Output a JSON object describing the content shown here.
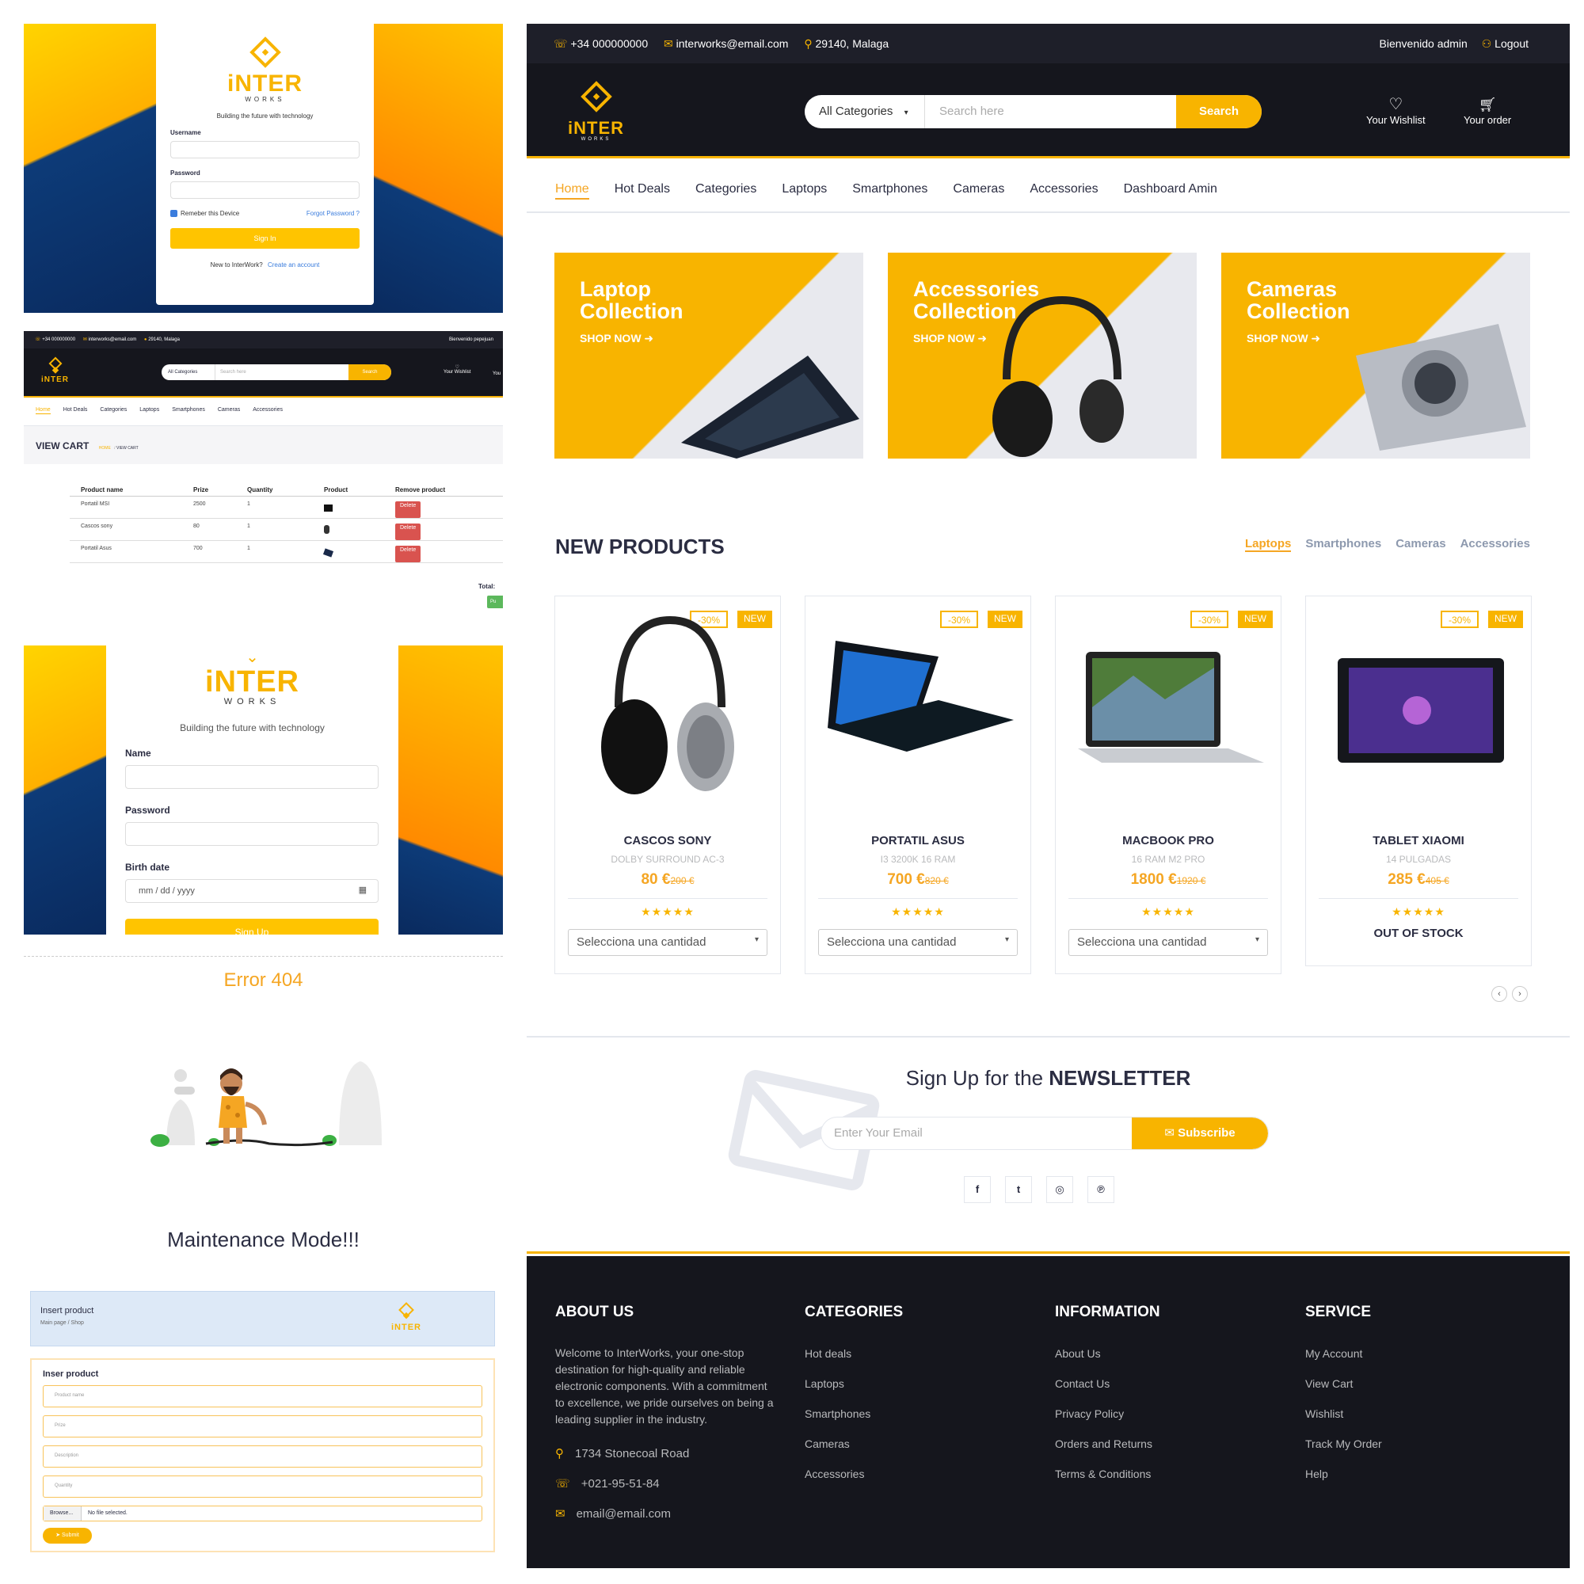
{
  "brand": {
    "name": "iNTER",
    "sub": "WORKS",
    "tagline": "Building the future with technology"
  },
  "login": {
    "username_label": "Username",
    "password_label": "Password",
    "remember_label": "Remeber this Device",
    "forgot_link": "Forgot Password ?",
    "signin_button": "Sign In",
    "new_text": "New to InterWork?",
    "create_link": "Create an account"
  },
  "cart_page": {
    "topbar": {
      "phone": "+34 000000000",
      "email": "interworks@email.com",
      "location": "29140, Malaga",
      "welcome": "Bienvenido pepejuan"
    },
    "search": {
      "category": "All Categories",
      "placeholder": "Search here",
      "button": "Search"
    },
    "wishlist": "Your Wishlist",
    "your_cut": "You",
    "nav": [
      "Home",
      "Hot Deals",
      "Categories",
      "Laptops",
      "Smartphones",
      "Cameras",
      "Accessories"
    ],
    "title": "VIEW CART",
    "breadcrumb": [
      "HOME",
      "VIEW CART"
    ],
    "columns": [
      "Product name",
      "Prize",
      "Quantity",
      "Product",
      "Remove product"
    ],
    "rows": [
      {
        "name": "Portatil MSI",
        "price": "2500",
        "qty": "1",
        "action": "Delete"
      },
      {
        "name": "Cascos sony",
        "price": "80",
        "qty": "1",
        "action": "Delete"
      },
      {
        "name": "Portatil Asus",
        "price": "700",
        "qty": "1",
        "action": "Delete"
      }
    ],
    "total": "Total: ",
    "buy_cut": "Pu"
  },
  "signup": {
    "name_label": "Name",
    "password_label": "Password",
    "birth_label": "Birth date",
    "birth_placeholder": "mm / dd / yyyy",
    "signup_button": "Sign Up"
  },
  "error_page": {
    "title": "Error 404",
    "message": "Maintenance Mode!!!"
  },
  "insert_page": {
    "header_title": "Insert product",
    "breadcrumb": [
      "Main page",
      "Shop"
    ],
    "form_title": "Inser product",
    "placeholders": [
      "Product name",
      "Prize",
      "Description",
      "Quantity"
    ],
    "browse": "Browse...",
    "no_file": "No file selected.",
    "submit": "Submit"
  },
  "home": {
    "topbar": {
      "phone": "+34 000000000",
      "email": "interworks@email.com",
      "location": "29140, Malaga",
      "welcome": "Bienvenido admin",
      "logout": "Logout"
    },
    "search": {
      "category": "All Categories",
      "placeholder": "Search here",
      "button": "Search"
    },
    "wishlist": "Your Wishlist",
    "order": "Your order",
    "nav": [
      "Home",
      "Hot Deals",
      "Categories",
      "Laptops",
      "Smartphones",
      "Cameras",
      "Accessories",
      "Dashboard Amin"
    ],
    "collections": [
      {
        "line1": "Laptop",
        "line2": "Collection",
        "cta": "SHOP NOW"
      },
      {
        "line1": "Accessories",
        "line2": "Collection",
        "cta": "SHOP NOW"
      },
      {
        "line1": "Cameras",
        "line2": "Collection",
        "cta": "SHOP NOW"
      }
    ],
    "new_products_title": "NEW PRODUCTS",
    "product_tabs": [
      "Laptops",
      "Smartphones",
      "Cameras",
      "Accessories"
    ],
    "products": [
      {
        "discount": "-30%",
        "badge": "NEW",
        "name": "CASCOS SONY",
        "desc": "DOLBY SURROUND AC-3",
        "price": "80 €",
        "old_price": "200 €",
        "action": "Selecciona una cantidad"
      },
      {
        "discount": "-30%",
        "badge": "NEW",
        "name": "PORTATIL ASUS",
        "desc": "I3 3200K 16 RAM",
        "price": "700 €",
        "old_price": "820 €",
        "action": "Selecciona una cantidad"
      },
      {
        "discount": "-30%",
        "badge": "NEW",
        "name": "MACBOOK PRO",
        "desc": "16 RAM M2 PRO",
        "price": "1800 €",
        "old_price": "1920 €",
        "action": "Selecciona una cantidad"
      },
      {
        "discount": "-30%",
        "badge": "NEW",
        "name": "TABLET XIAOMI",
        "desc": "14 PULGADAS",
        "price": "285 €",
        "old_price": "405 €",
        "action": "OUT OF STOCK"
      }
    ],
    "newsletter": {
      "prefix": "Sign Up for the ",
      "strong": "NEWSLETTER",
      "placeholder": "Enter Your Email",
      "button": "Subscribe"
    },
    "footer": {
      "about": {
        "title": "ABOUT US",
        "text": "Welcome to InterWorks, your one-stop destination for high-quality and reliable electronic components. With a commitment to excellence, we pride ourselves on being a leading supplier in the industry.",
        "address": "1734 Stonecoal Road",
        "phone": "+021-95-51-84",
        "email": "email@email.com"
      },
      "categories": {
        "title": "CATEGORIES",
        "items": [
          "Hot deals",
          "Laptops",
          "Smartphones",
          "Cameras",
          "Accessories"
        ]
      },
      "information": {
        "title": "INFORMATION",
        "items": [
          "About Us",
          "Contact Us",
          "Privacy Policy",
          "Orders and Returns",
          "Terms & Conditions"
        ]
      },
      "service": {
        "title": "SERVICE",
        "items": [
          "My Account",
          "View Cart",
          "Wishlist",
          "Track My Order",
          "Help"
        ]
      }
    }
  },
  "colors": {
    "brand_yellow": "#f8b400",
    "dark_nav": "#15161d",
    "accent_orange": "#f5a623"
  },
  "icons": [
    "phone-icon",
    "mail-icon",
    "pin-icon",
    "user-icon",
    "heart-icon",
    "cart-icon",
    "calendar-icon",
    "facebook-icon",
    "twitter-icon",
    "instagram-icon",
    "pinterest-icon",
    "envelope-icon"
  ]
}
